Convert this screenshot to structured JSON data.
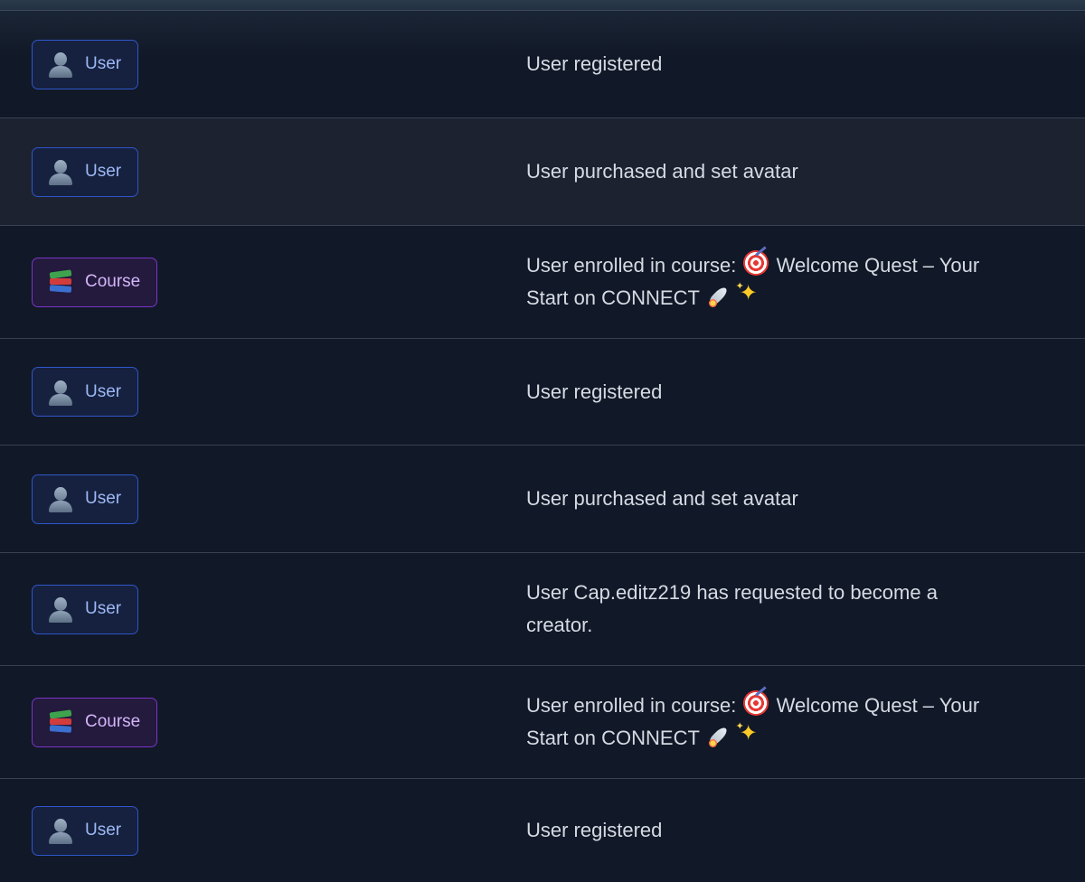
{
  "activity_log": {
    "rows": [
      {
        "badge": "User",
        "type": "user",
        "description": "User registered"
      },
      {
        "badge": "User",
        "type": "user",
        "description": "User purchased and set avatar"
      },
      {
        "badge": "Course",
        "type": "course",
        "description_prefix": "User enrolled in course:",
        "course_name_part1": "Welcome Quest – Your",
        "course_name_part2": "Start on CONNECT"
      },
      {
        "badge": "User",
        "type": "user",
        "description": "User registered"
      },
      {
        "badge": "User",
        "type": "user",
        "description": "User purchased and set avatar"
      },
      {
        "badge": "User",
        "type": "user",
        "description": "User Cap.editz219 has requested to become a creator."
      },
      {
        "badge": "Course",
        "type": "course",
        "description_prefix": "User enrolled in course:",
        "course_name_part1": "Welcome Quest – Your",
        "course_name_part2": "Start on CONNECT"
      },
      {
        "badge": "User",
        "type": "user",
        "description": "User registered"
      }
    ]
  },
  "icons": {
    "user_badge": "bust-silhouette-icon",
    "course_badge": "books-icon",
    "target": "direct-hit-icon",
    "rocket": "rocket-icon",
    "sparkles": "sparkles-icon"
  },
  "colors": {
    "background": "#111827",
    "row_divider": "#374151",
    "user_badge_border": "#2f56c9",
    "user_badge_text": "#9db8f5",
    "course_badge_border": "#7a35c8",
    "course_badge_text": "#d4b5f7",
    "description_text": "#d6dbe3"
  }
}
